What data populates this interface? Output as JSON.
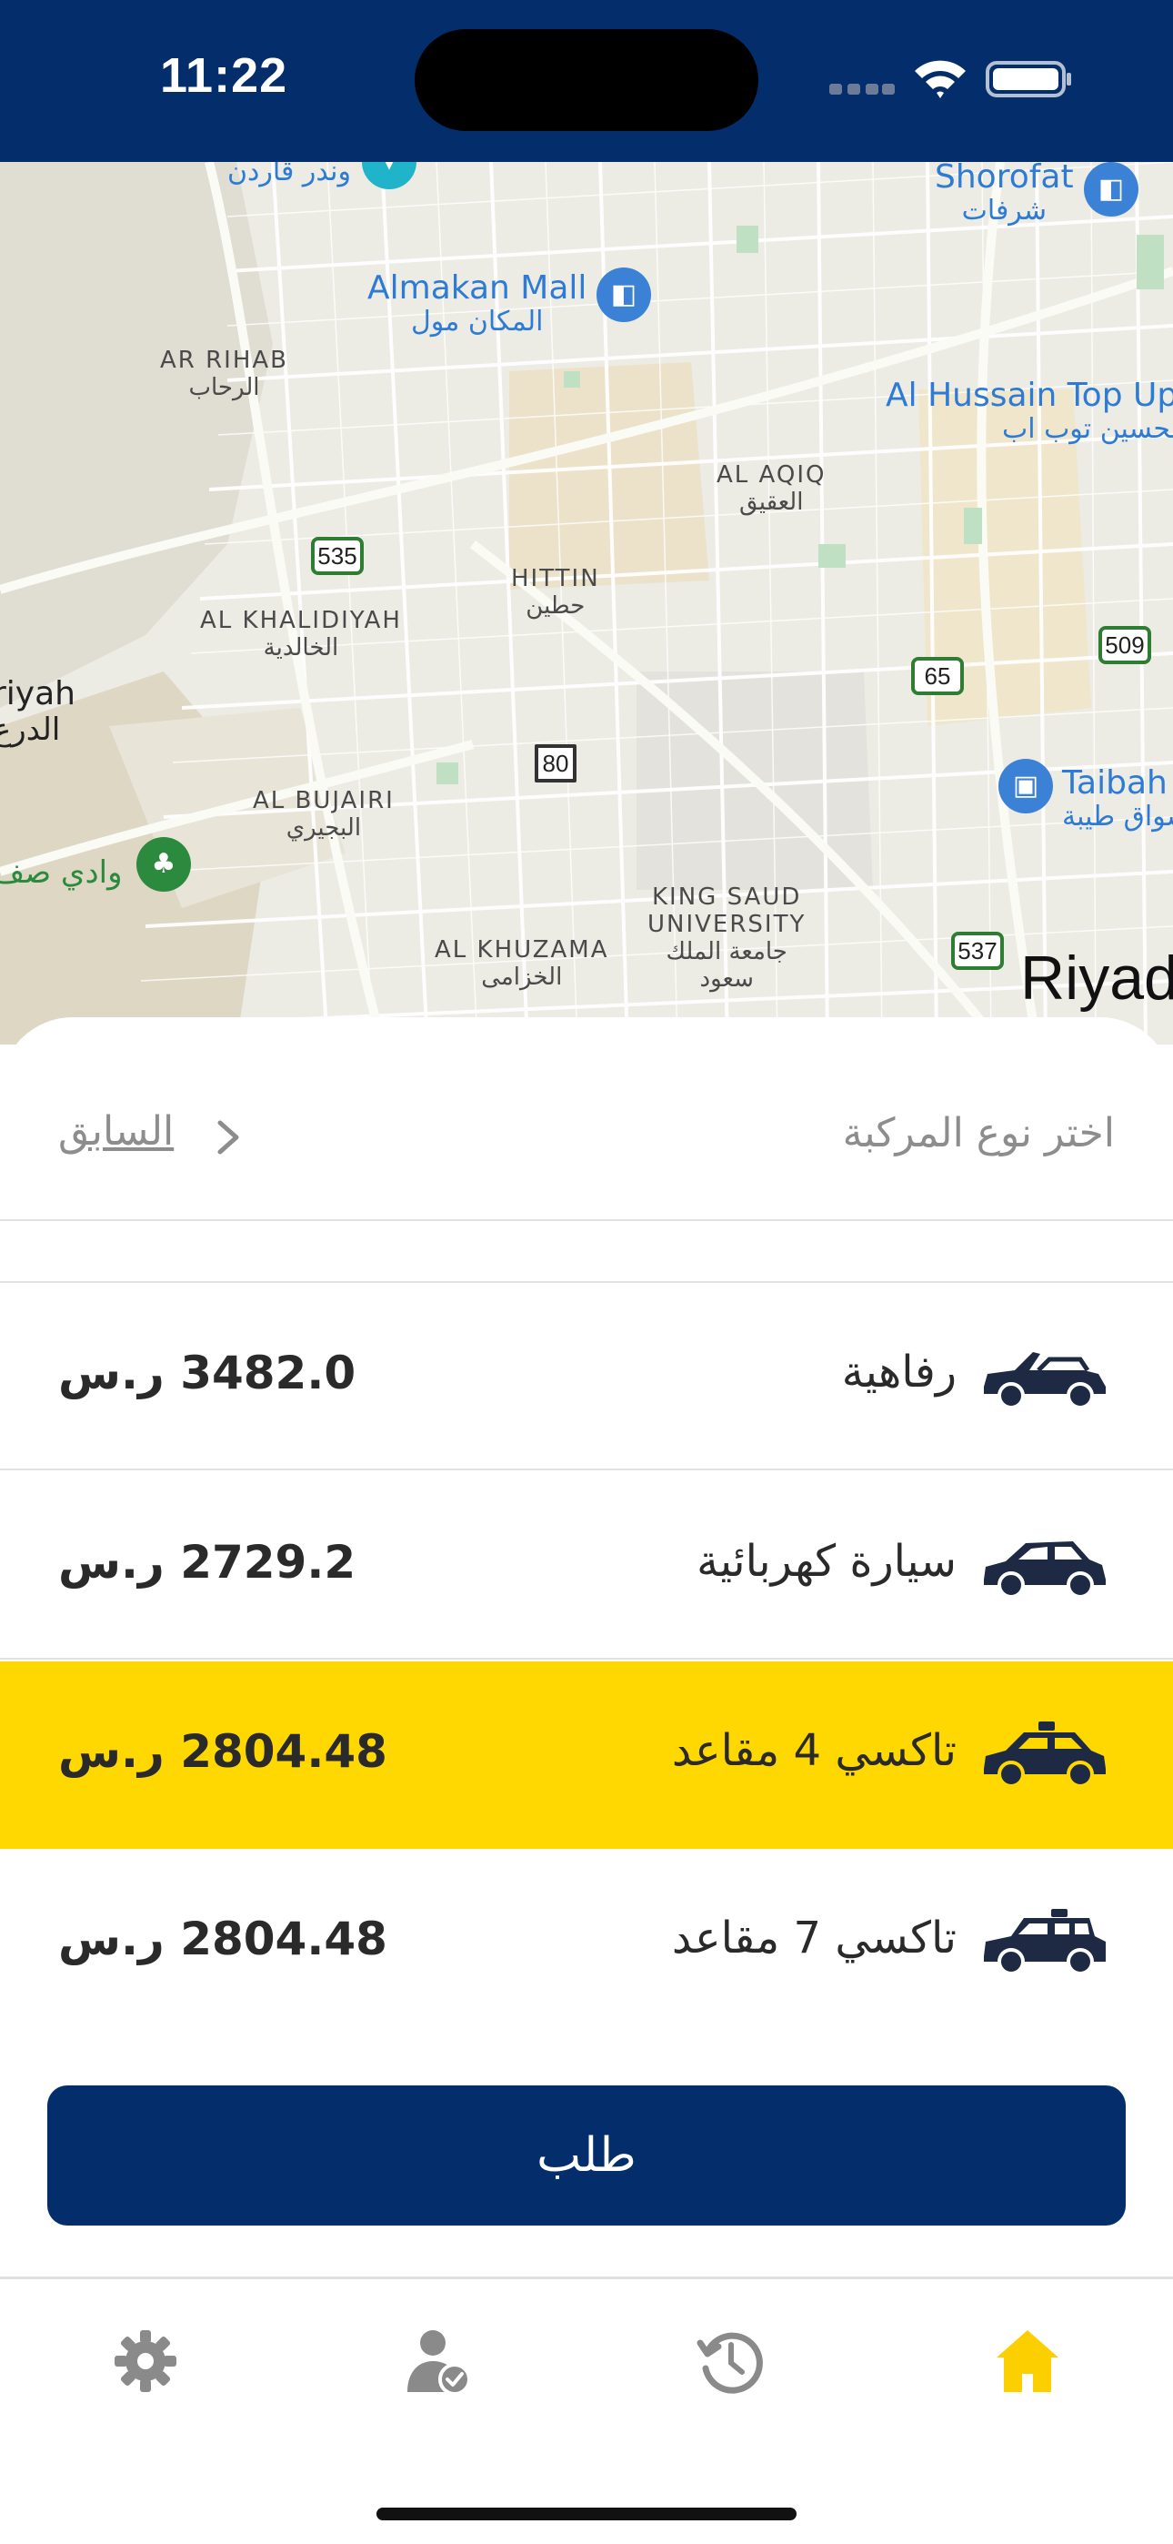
{
  "status_bar": {
    "time": "11:22"
  },
  "map": {
    "labels": {
      "wonder_garden_ar": "وندر قاردن",
      "shorofat_en": "Shorofat",
      "shorofat_ar": "شرفات",
      "almakan_en": "Almakan Mall",
      "almakan_ar": "المكان مول",
      "ar_rihab_en": "AR RIHAB",
      "ar_rihab_ar": "الرحاب",
      "al_hussain_en": "Al Hussain Top Up",
      "al_hussain_ar": "الحسين توب اب",
      "al_aqiq_en": "AL AQIQ",
      "al_aqiq_ar": "العقيق",
      "hittin_en": "HITTIN",
      "hittin_ar": "حطين",
      "al_khalidiyah_en": "AL KHALIDIYAH",
      "al_khalidiyah_ar": "الخالدية",
      "diriyah_en": "riyah",
      "diriyah_ar": "الدرع",
      "taibah_en": "Taibah",
      "taibah_ar": "أسواق طيبة",
      "al_bujairi_en": "AL BUJAIRI",
      "al_bujairi_ar": "البجيري",
      "wadi_ar": "وادي صف",
      "ksu_en_1": "KING SAUD",
      "ksu_en_2": "UNIVERSITY",
      "ksu_ar_1": "جامعة الملك",
      "ksu_ar_2": "سعود",
      "al_khuzama_en": "AL KHUZAMA",
      "al_khuzama_ar": "الخزامى",
      "riyadh_en": "Riyad"
    },
    "shields": {
      "r535": "535",
      "r509": "509",
      "r65": "65",
      "r80": "80",
      "r537": "537"
    }
  },
  "sheet": {
    "title": "اختر نوع المركبة",
    "back_label": "السابق"
  },
  "vehicles": [
    {
      "name": "رفاهية",
      "price": "3482.0 ر.س",
      "icon": "convertible-car-icon",
      "selected": false
    },
    {
      "name": "سيارة كهربائية",
      "price": "2729.2 ر.س",
      "icon": "hatchback-car-icon",
      "selected": false
    },
    {
      "name": "تاكسي 4 مقاعد",
      "price": "2804.48 ر.س",
      "icon": "taxi-4-seat-icon",
      "selected": true
    },
    {
      "name": "تاكسي 7 مقاعد",
      "price": "2804.48 ر.س",
      "icon": "taxi-7-seat-icon",
      "selected": false
    }
  ],
  "request_button": {
    "label": "طلب"
  },
  "tabbar": {
    "tabs": [
      {
        "icon": "settings-icon",
        "active": false
      },
      {
        "icon": "profile-verified-icon",
        "active": false
      },
      {
        "icon": "history-icon",
        "active": false
      },
      {
        "icon": "home-icon",
        "active": true
      }
    ]
  },
  "colors": {
    "brand_navy": "#032d6b",
    "selected_yellow": "#fed800",
    "active_tab": "#fcd000",
    "inactive_tab": "#8a8a8a"
  }
}
